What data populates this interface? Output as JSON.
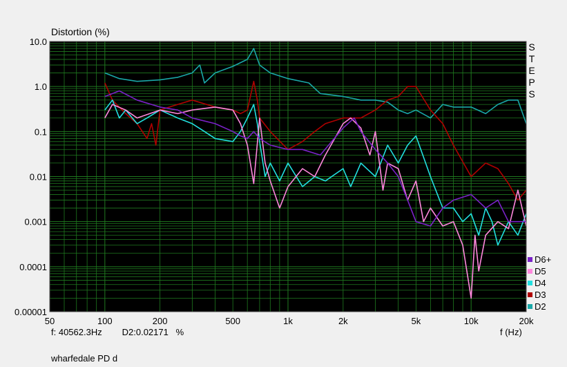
{
  "chart_data": {
    "type": "line",
    "ylabel": "Distortion (%)",
    "xlabel": "f (Hz)",
    "x_scale": "log",
    "y_scale": "log",
    "xlim": [
      50,
      20000
    ],
    "ylim": [
      1e-05,
      10
    ],
    "grid": true,
    "background": "#000000",
    "grid_color": "#1f7a1f",
    "x_ticks": [
      50,
      100,
      200,
      500,
      1000,
      2000,
      5000,
      10000,
      20000
    ],
    "x_tick_labels": [
      "50",
      "100",
      "200",
      "500",
      "1k",
      "2k",
      "5k",
      "10k",
      "20k"
    ],
    "y_ticks": [
      1e-05,
      0.0001,
      0.001,
      0.01,
      0.1,
      1,
      10
    ],
    "y_tick_labels": [
      "0.00001",
      "0.0001",
      "0.001",
      "0.01",
      "0.1",
      "1.0",
      "10.0"
    ],
    "legend_position": "bottom-right",
    "series": [
      {
        "name": "D2",
        "color": "#1aa8a8",
        "x": [
          100,
          120,
          150,
          200,
          250,
          300,
          330,
          350,
          400,
          500,
          600,
          650,
          700,
          800,
          1000,
          1300,
          1500,
          2000,
          2500,
          3000,
          3500,
          4000,
          4500,
          5000,
          6000,
          7000,
          8000,
          10000,
          12000,
          14000,
          16000,
          18000,
          20000
        ],
        "y": [
          2.0,
          1.5,
          1.3,
          1.4,
          1.6,
          2.0,
          3.0,
          1.2,
          2.0,
          2.8,
          4.0,
          7.0,
          3.0,
          2.0,
          1.5,
          1.2,
          0.7,
          0.6,
          0.5,
          0.5,
          0.45,
          0.3,
          0.25,
          0.3,
          0.2,
          0.4,
          0.35,
          0.35,
          0.25,
          0.4,
          0.5,
          0.5,
          0.15
        ]
      },
      {
        "name": "D3",
        "color": "#b00000",
        "x": [
          100,
          110,
          130,
          150,
          170,
          180,
          190,
          200,
          250,
          300,
          400,
          500,
          550,
          600,
          650,
          680,
          700,
          800,
          1000,
          1200,
          1400,
          1600,
          2000,
          2500,
          3000,
          3500,
          4000,
          4500,
          5000,
          6000,
          7000,
          8000,
          10000,
          12000,
          14000,
          16000,
          18000,
          20000
        ],
        "y": [
          1.2,
          0.5,
          0.25,
          0.15,
          0.07,
          0.15,
          0.05,
          0.3,
          0.4,
          0.5,
          0.35,
          0.3,
          0.25,
          0.3,
          1.3,
          0.5,
          0.2,
          0.1,
          0.04,
          0.06,
          0.1,
          0.15,
          0.2,
          0.2,
          0.3,
          0.5,
          0.6,
          1.0,
          1.0,
          0.3,
          0.15,
          0.05,
          0.01,
          0.02,
          0.015,
          0.007,
          0.003,
          0.005
        ]
      },
      {
        "name": "D4",
        "color": "#22e0e0",
        "x": [
          100,
          110,
          120,
          130,
          150,
          170,
          200,
          250,
          300,
          350,
          400,
          500,
          550,
          600,
          650,
          680,
          700,
          750,
          800,
          900,
          1000,
          1200,
          1400,
          1600,
          2000,
          2200,
          2500,
          3000,
          3500,
          4000,
          4500,
          5000,
          6000,
          7000,
          8000,
          9000,
          10000,
          11000,
          12000,
          13000,
          14000,
          16000,
          18000,
          20000
        ],
        "y": [
          0.3,
          0.5,
          0.2,
          0.3,
          0.15,
          0.2,
          0.3,
          0.2,
          0.15,
          0.1,
          0.07,
          0.06,
          0.1,
          0.2,
          0.4,
          0.15,
          0.06,
          0.01,
          0.02,
          0.008,
          0.02,
          0.006,
          0.01,
          0.008,
          0.015,
          0.006,
          0.02,
          0.01,
          0.05,
          0.02,
          0.05,
          0.08,
          0.01,
          0.002,
          0.002,
          0.001,
          0.0015,
          0.0005,
          0.002,
          0.001,
          0.0003,
          0.001,
          0.0005,
          0.0015
        ]
      },
      {
        "name": "D5",
        "color": "#ff88dd",
        "x": [
          100,
          110,
          130,
          150,
          200,
          250,
          300,
          400,
          500,
          550,
          600,
          650,
          700,
          750,
          800,
          900,
          1000,
          1200,
          1400,
          1600,
          2000,
          2200,
          2500,
          2800,
          3000,
          3300,
          3500,
          4000,
          4500,
          5000,
          5500,
          6000,
          7000,
          8000,
          9000,
          10000,
          10500,
          11000,
          12000,
          14000,
          16000,
          18000,
          20000
        ],
        "y": [
          0.2,
          0.4,
          0.3,
          0.2,
          0.3,
          0.25,
          0.3,
          0.35,
          0.3,
          0.15,
          0.05,
          0.007,
          0.2,
          0.02,
          0.008,
          0.002,
          0.006,
          0.015,
          0.01,
          0.03,
          0.15,
          0.2,
          0.12,
          0.03,
          0.1,
          0.005,
          0.02,
          0.015,
          0.003,
          0.008,
          0.001,
          0.002,
          0.0008,
          0.001,
          0.0003,
          2e-05,
          0.0005,
          8e-05,
          0.0005,
          0.001,
          0.0007,
          0.005,
          0.0008
        ]
      },
      {
        "name": "D6+",
        "color": "#7a22c8",
        "x": [
          100,
          120,
          150,
          200,
          250,
          300,
          400,
          500,
          550,
          600,
          650,
          700,
          800,
          1000,
          1200,
          1500,
          2000,
          2300,
          2500,
          3000,
          3500,
          4000,
          4500,
          5000,
          6000,
          7000,
          8000,
          10000,
          12000,
          14000,
          16000,
          18000,
          20000
        ],
        "y": [
          0.6,
          0.8,
          0.5,
          0.35,
          0.3,
          0.2,
          0.15,
          0.1,
          0.08,
          0.07,
          0.1,
          0.07,
          0.05,
          0.04,
          0.04,
          0.03,
          0.12,
          0.2,
          0.1,
          0.04,
          0.02,
          0.01,
          0.003,
          0.001,
          0.0008,
          0.002,
          0.003,
          0.004,
          0.002,
          0.003,
          0.001,
          0.001,
          0.001
        ]
      }
    ]
  },
  "status": {
    "freq": "f: 40562.3Hz",
    "reading": "D2:0.02171   %"
  },
  "side_label": "STEPS",
  "footer": "wharfedale PD d"
}
